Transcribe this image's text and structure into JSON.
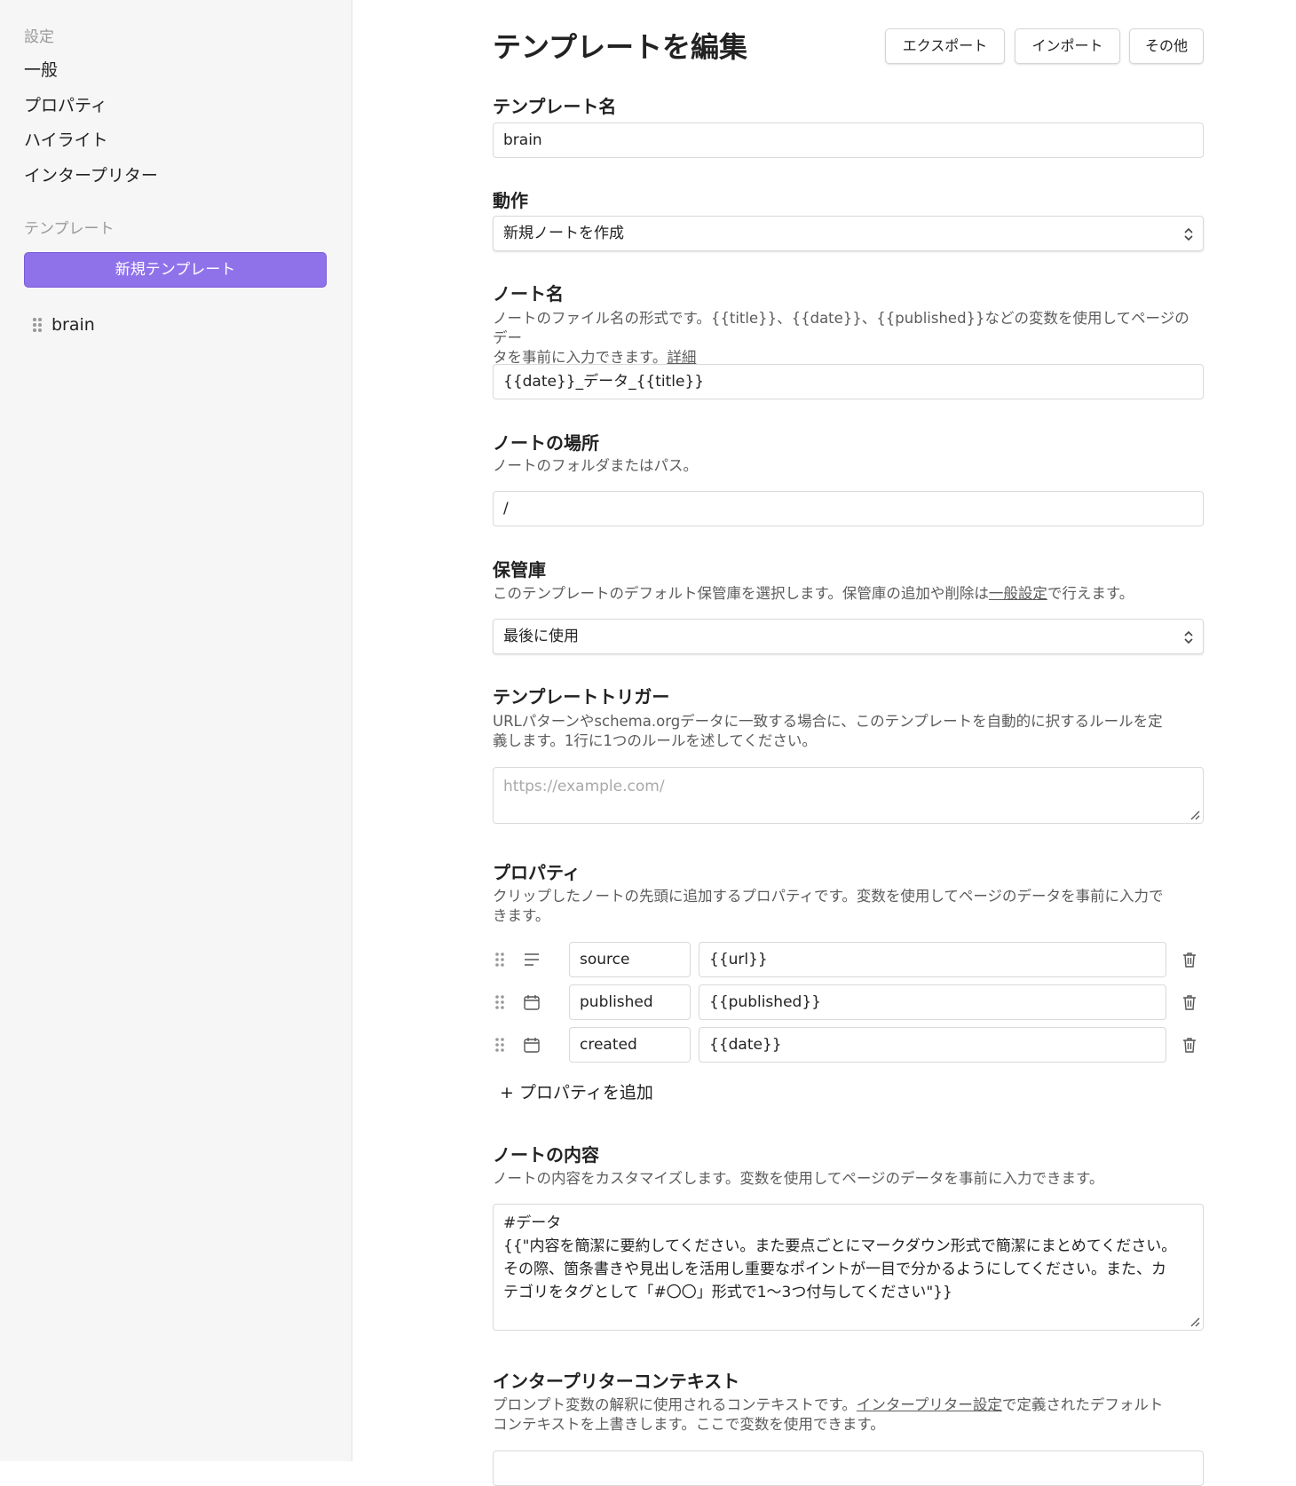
{
  "sidebar": {
    "settings_heading": "設定",
    "settings_items": [
      {
        "label": "一般"
      },
      {
        "label": "プロパティ"
      },
      {
        "label": "ハイライト"
      },
      {
        "label": "インタープリター"
      }
    ],
    "templates_heading": "テンプレート",
    "new_template_label": "新規テンプレート",
    "templates": [
      {
        "name": "brain"
      }
    ]
  },
  "header": {
    "title": "テンプレートを編集",
    "export_label": "エクスポート",
    "import_label": "インポート",
    "more_label": "その他"
  },
  "template_name": {
    "label": "テンプレート名",
    "value": "brain"
  },
  "behavior": {
    "label": "動作",
    "value": "新規ノートを作成"
  },
  "note_name": {
    "label": "ノート名",
    "description": "ノートのファイル名の形式です。{{title}}、{{date}}、{{published}}などの変数を使用してページのデー",
    "description_line2": "タを事前に入力できます。",
    "link": "詳細",
    "value": "{{date}}_データ_{{title}}"
  },
  "note_location": {
    "label": "ノートの場所",
    "description": "ノートのフォルダまたはパス。",
    "value": "/"
  },
  "vault": {
    "label": "保管庫",
    "description_pre": "このテンプレートのデフォルト保管庫を選択します。保管庫の追加や削除は",
    "link": "一般設定",
    "description_post": "で行えます。",
    "value": "最後に使用"
  },
  "triggers": {
    "label": "テンプレートトリガー",
    "description": "URLパターンやschema.orgデータに一致する場合に、このテンプレートを自動的に択するルールを定",
    "description_line2": "義します。1行に1つのルールを述してください。",
    "placeholder": "https://example.com/"
  },
  "properties": {
    "label": "プロパティ",
    "description": "クリップしたノートの先頭に追加するプロパティです。変数を使用してページのデータを事前に入力で",
    "description_line2": "きます。",
    "rows": [
      {
        "type_icon": "text-lines-icon",
        "name": "source",
        "value": "{{url}}"
      },
      {
        "type_icon": "calendar-icon",
        "name": "published",
        "value": "{{published}}"
      },
      {
        "type_icon": "calendar-icon",
        "name": "created",
        "value": "{{date}}"
      }
    ],
    "add_label": "+ プロパティを追加"
  },
  "note_content": {
    "label": "ノートの内容",
    "description": "ノートの内容をカスタマイズします。変数を使用してページのデータを事前に入力できます。",
    "lines": [
      "#データ",
      "{{\"内容を簡潔に要約してください。また要点ごとにマークダウン形式で簡潔にまとめてください。",
      "その際、箇条書きや見出しを活用し重要なポイントが一目で分かるようにしてください。また、カ",
      "テゴリをタグとして「#〇〇」形式で1〜3つ付与してください\"}}"
    ]
  },
  "interpreter_context": {
    "label": "インタープリターコンテキスト",
    "description_pre": "プロンプト変数の解釈に使用されるコンテキストです。",
    "link": "インタープリター設定",
    "description_post": "で定義されたデフォルト",
    "description_line2": "コンテキストを上書きします。ここで変数を使用できます。"
  },
  "colors": {
    "accent": "#8f72ea",
    "sidebar_bg": "#f6f6f6"
  }
}
